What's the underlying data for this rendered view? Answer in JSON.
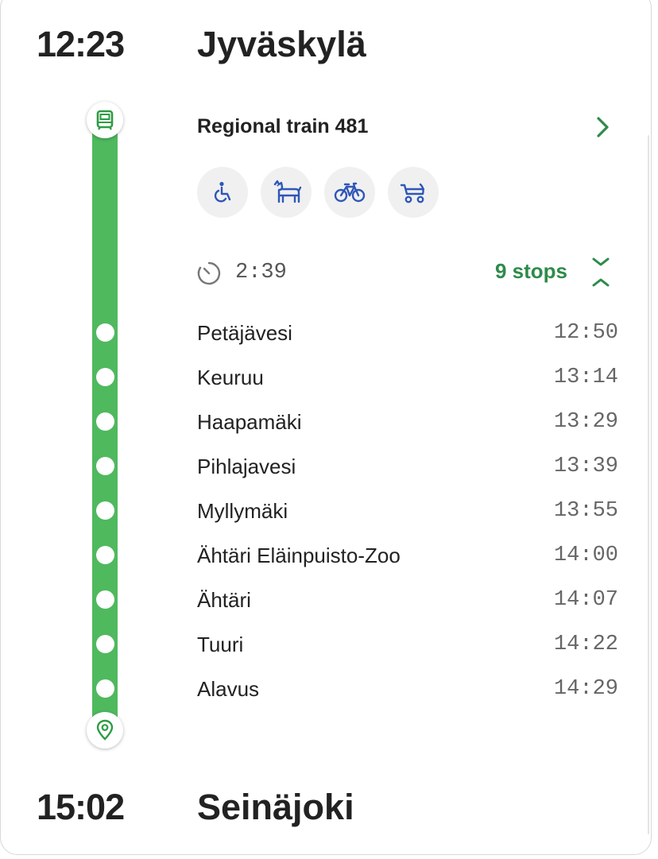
{
  "origin": {
    "time": "12:23",
    "station": "Jyväskylä"
  },
  "destination": {
    "time": "15:02",
    "station": "Seinäjoki"
  },
  "route": {
    "name": "Regional train 481"
  },
  "amenities": [
    "wheelchair-icon",
    "pet-icon",
    "bicycle-icon",
    "stroller-icon"
  ],
  "journey": {
    "duration": "2:39",
    "stops_label": "9 stops"
  },
  "stops": [
    {
      "name": "Petäjävesi",
      "time": "12:50"
    },
    {
      "name": "Keuruu",
      "time": "13:14"
    },
    {
      "name": "Haapamäki",
      "time": "13:29"
    },
    {
      "name": "Pihlajavesi",
      "time": "13:39"
    },
    {
      "name": "Myllymäki",
      "time": "13:55"
    },
    {
      "name": "Ähtäri Eläinpuisto-Zoo",
      "time": "14:00"
    },
    {
      "name": "Ähtäri",
      "time": "14:07"
    },
    {
      "name": "Tuuri",
      "time": "14:22"
    },
    {
      "name": "Alavus",
      "time": "14:29"
    }
  ],
  "colors": {
    "rail": "#4fb95e",
    "accent": "#2e8b4a",
    "amenity_icon": "#2f56b8"
  }
}
